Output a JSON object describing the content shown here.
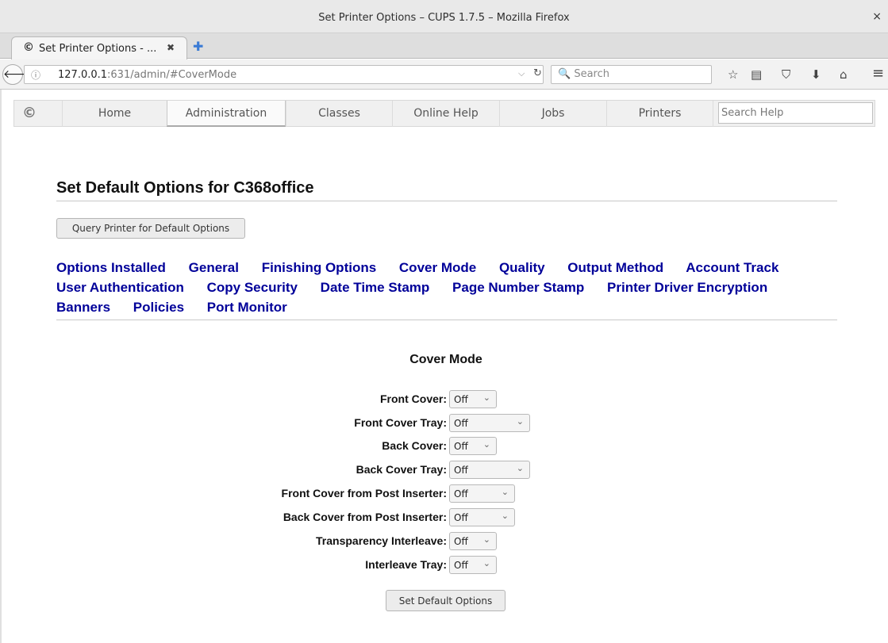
{
  "window": {
    "title": "Set Printer Options – CUPS 1.7.5 – Mozilla Firefox",
    "close_glyph": "×"
  },
  "tab": {
    "title": "Set Printer Options - ...",
    "close_glyph": "✖",
    "favicon": "cups-icon",
    "new_tab_glyph": "✚"
  },
  "navbar": {
    "back_glyph": "🡐",
    "info_glyph": "ⓘ",
    "url_host": "127.0.0.1",
    "url_rest": ":631/admin/#CoverMode",
    "url_dropdown_glyph": "⌵",
    "reload_glyph": "↻",
    "search_placeholder": "🔍 Search",
    "icons": {
      "bookmark": "☆",
      "reader": "▤",
      "pocket": "⛉",
      "download": "⬇",
      "home": "⌂",
      "menu": "≡"
    }
  },
  "cups": {
    "logo": "©",
    "tabs": [
      "Home",
      "Administration",
      "Classes",
      "Online Help",
      "Jobs",
      "Printers"
    ],
    "active_tab": "Administration",
    "search_placeholder": "Search Help"
  },
  "page": {
    "title": "Set Default Options for C368office",
    "query_button": "Query Printer for Default Options",
    "section_links": [
      "Options Installed",
      "General",
      "Finishing Options",
      "Cover Mode",
      "Quality",
      "Output Method",
      "Account Track",
      "User Authentication",
      "Copy Security",
      "Date Time Stamp",
      "Page Number Stamp",
      "Printer Driver Encryption",
      "Banners",
      "Policies",
      "Port Monitor"
    ],
    "section_title": "Cover Mode",
    "options": [
      {
        "label": "Front Cover:",
        "value": "Off"
      },
      {
        "label": "Front Cover Tray:",
        "value": "Off"
      },
      {
        "label": "Back Cover:",
        "value": "Off"
      },
      {
        "label": "Back Cover Tray:",
        "value": "Off"
      },
      {
        "label": "Front Cover from Post Inserter:",
        "value": "Off"
      },
      {
        "label": "Back Cover from Post Inserter:",
        "value": "Off"
      },
      {
        "label": "Transparency Interleave:",
        "value": "Off"
      },
      {
        "label": "Interleave Tray:",
        "value": "Off"
      }
    ],
    "submit_button": "Set Default Options"
  },
  "colors": {
    "link": "#000099",
    "chrome": "#e9e9e9"
  }
}
